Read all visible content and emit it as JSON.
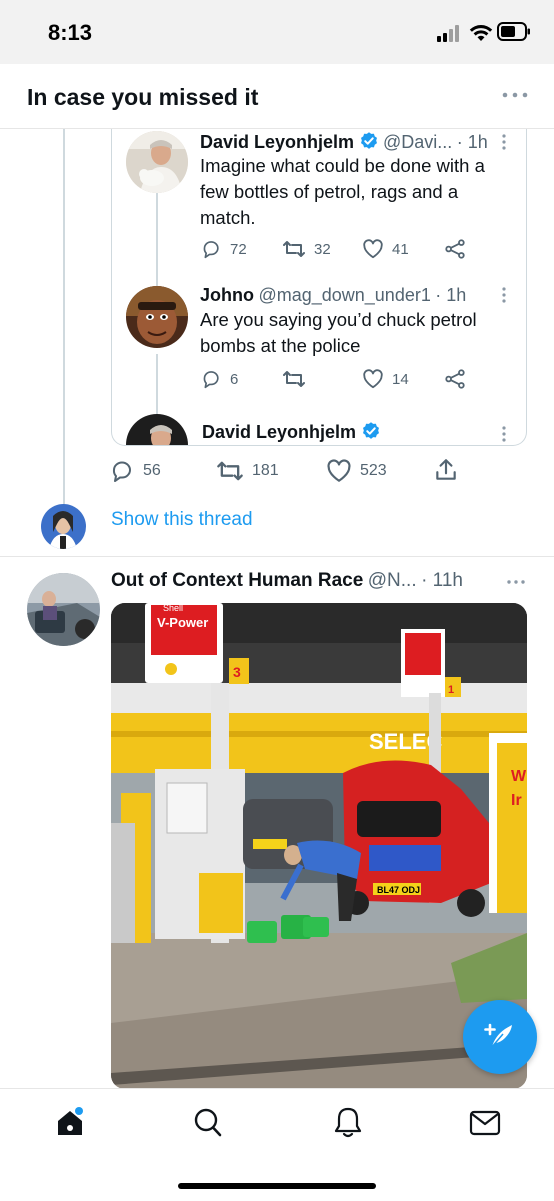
{
  "status_bar": {
    "time": "8:13"
  },
  "header": {
    "title": "In case you missed it"
  },
  "thread": {
    "quoted_tweets": [
      {
        "name": "David Leyonhjelm",
        "handle": "@Davi...",
        "time": "· 1h",
        "text": "Imagine what could be done with a few bottles of petrol, rags and a match.",
        "replies": "72",
        "retweets": "32",
        "likes": "41"
      },
      {
        "name": "Johno",
        "handle": "@mag_down_under1",
        "time": "· 1h",
        "text": "Are you saying you’d chuck petrol bombs at the police",
        "replies": "6",
        "retweets": "",
        "likes": "14"
      },
      {
        "name": "David Leyonhjelm"
      }
    ],
    "actions": {
      "replies": "56",
      "retweets": "181",
      "likes": "523"
    },
    "show_thread": "Show this thread"
  },
  "tweet2": {
    "name": "Out of Context Human Race",
    "handle": "@N...",
    "time": "· 11h",
    "media_signs": {
      "shell_top": "Shell",
      "vpower": "V-Power",
      "pump_number": "3",
      "pump_number_2": "1",
      "select": "SELEC",
      "plate": "BL47 ODJ",
      "side_sign": "W\nIr"
    }
  },
  "colors": {
    "accent": "#1d9bf0",
    "text": "#0f1419",
    "muted": "#536471",
    "border": "#cfd9de"
  },
  "tab_bar": {
    "items": [
      "home-icon",
      "search-icon",
      "notifications-icon",
      "messages-icon"
    ]
  }
}
